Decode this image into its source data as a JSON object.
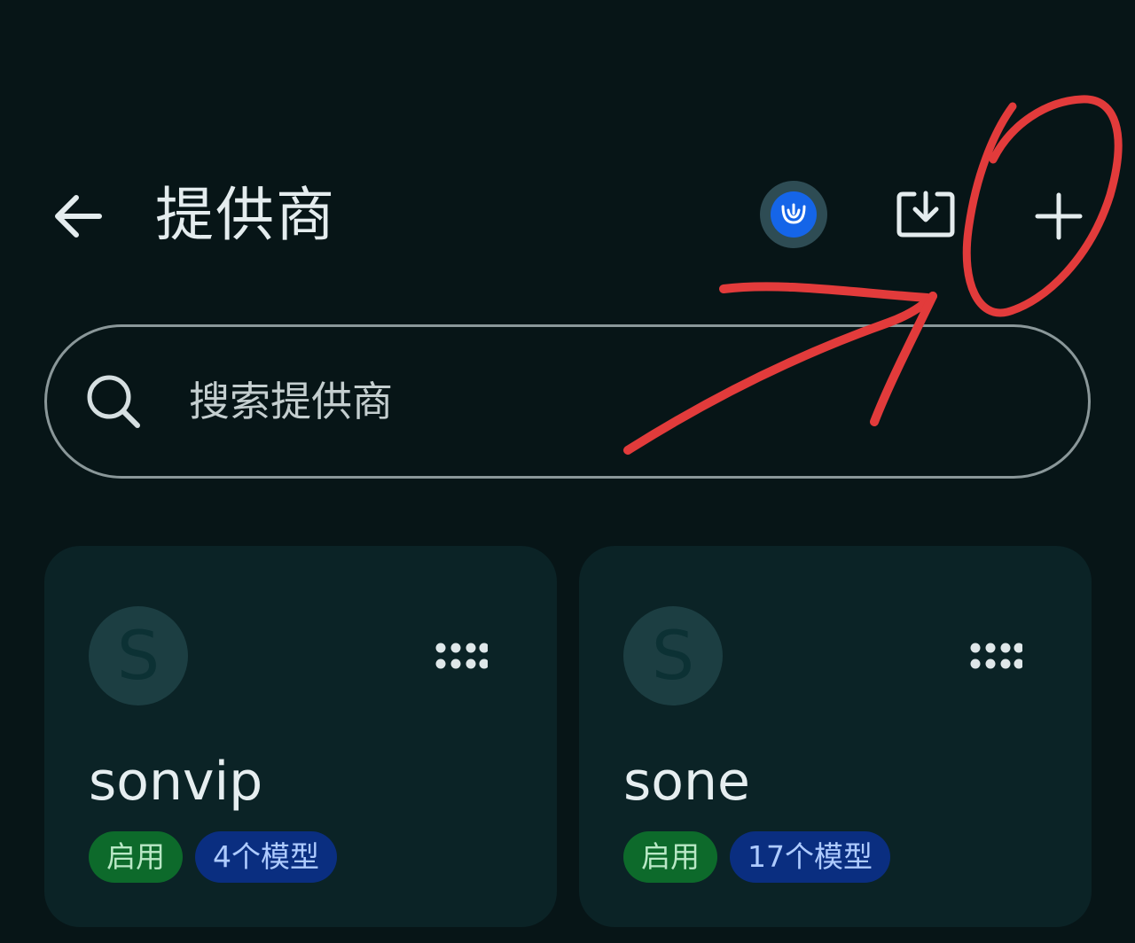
{
  "header": {
    "title": "提供商",
    "back_icon": "arrow-left-icon",
    "badge_icon": "crown-icon",
    "import_icon": "download-tray-icon",
    "add_icon": "plus-icon"
  },
  "search": {
    "placeholder": "搜索提供商",
    "value": "",
    "icon": "search-icon"
  },
  "providers": [
    {
      "avatar_letter": "S",
      "name": "sonvip",
      "status": "启用",
      "models": "4个模型",
      "menu_icon": "grid-dots-icon"
    },
    {
      "avatar_letter": "S",
      "name": "sone",
      "status": "启用",
      "models": "17个模型",
      "menu_icon": "grid-dots-icon"
    }
  ],
  "colors": {
    "background": "#071517",
    "card": "#0b2326",
    "badge_blue": "#1565e8",
    "enabled_tag": "#0d6a2b",
    "models_tag": "#0a2e80",
    "annotation_red": "#e23b3b"
  }
}
